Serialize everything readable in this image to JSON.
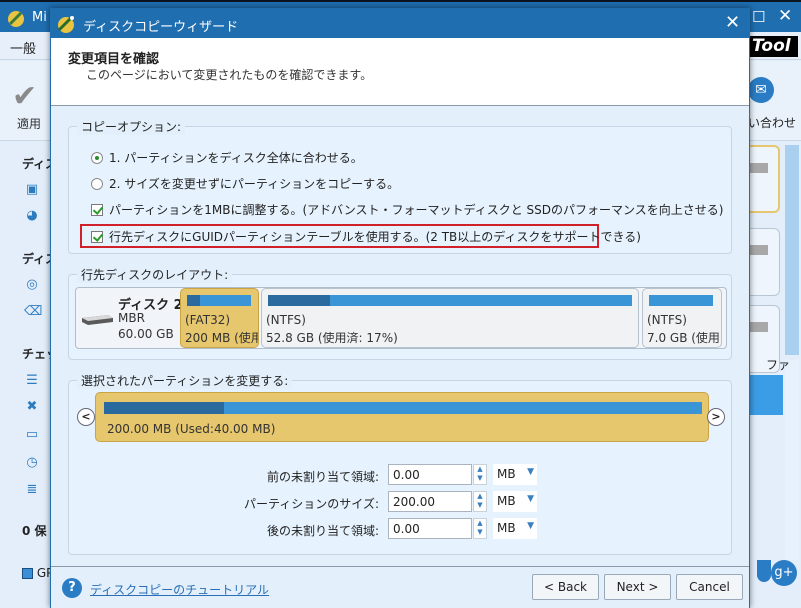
{
  "background_app": {
    "title": "Mi",
    "menu_general": "一般",
    "brand": "Tool",
    "apply_label": "適用",
    "contact_label": "い合わせ",
    "sidebar_headings": [
      "ディス",
      "ディス",
      "チェッ",
      "0 保"
    ],
    "status_label": "GP",
    "right_text": "ファ"
  },
  "dialog": {
    "title": "ディスクコピーウィザード",
    "header": {
      "title": "変更項目を確認",
      "subtitle": "このページにおいて変更されたものを確認できます。"
    },
    "copy_options": {
      "legend": "コピーオプション:",
      "options": [
        {
          "type": "radio",
          "label": "1. パーティションをディスク全体に合わせる。",
          "checked": true
        },
        {
          "type": "radio",
          "label": "2. サイズを変更せずにパーティションをコピーする。",
          "checked": false
        },
        {
          "type": "checkbox",
          "label": "パーティションを1MBに調整する。(アドバンスト・フォーマットディスクと SSDのパフォーマンスを向上させる)",
          "checked": true
        },
        {
          "type": "checkbox",
          "label": "行先ディスクにGUIDパーティションテーブルを使用する。(2 TB以上のディスクをサポートできる)",
          "checked": true,
          "highlighted": true
        }
      ]
    },
    "dest_layout": {
      "legend": "行先ディスクのレイアウト:",
      "disk": {
        "name": "ディスク 2",
        "type": "MBR",
        "size": "60.00 GB"
      },
      "partitions": [
        {
          "fs": "(FAT32)",
          "capacity": "200 MB (使用",
          "used_fraction": 0.2,
          "selected": true
        },
        {
          "fs": "(NTFS)",
          "capacity": "52.8 GB (使用済: 17%)",
          "used_fraction": 0.17,
          "selected": false
        },
        {
          "fs": "(NTFS)",
          "capacity": "7.0 GB (使用",
          "used_fraction": 0.0,
          "selected": false
        }
      ]
    },
    "modify": {
      "legend": "選択されたパーティションを変更する:",
      "partition_text": "200.00 MB (Used:40.00 MB)",
      "used_fraction": 0.2,
      "prev_icon": "chevron-left",
      "next_icon": "chevron-right",
      "fields": [
        {
          "label": "前の未割り当て領域:",
          "value": "0.00",
          "unit": "MB"
        },
        {
          "label": "パーティションのサイズ:",
          "value": "200.00",
          "unit": "MB"
        },
        {
          "label": "後の未割り当て領域:",
          "value": "0.00",
          "unit": "MB"
        }
      ]
    },
    "footer": {
      "tutorial_link": "ディスクコピーのチュートリアル",
      "back": "< Back",
      "next": "Next >",
      "cancel": "Cancel"
    }
  },
  "colors": {
    "titlebar": "#1f6eb0",
    "selected_partition": "#e6c76e",
    "bar": "#3a95d6",
    "used": "#2b6a9e",
    "highlight": "#d0202a"
  }
}
